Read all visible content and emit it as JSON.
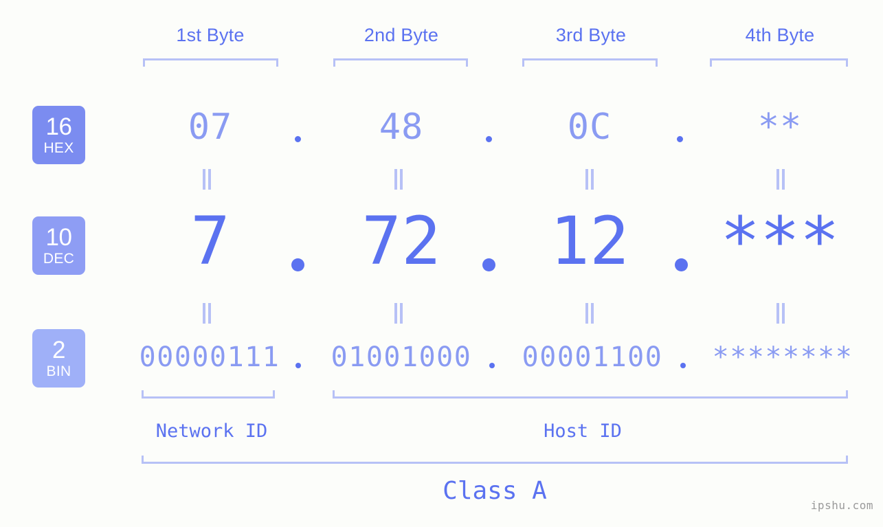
{
  "background_color": "#fcfdfa",
  "accent_color": "#5b72f0",
  "accent_light_color": "#8a9bf2",
  "bracket_color": "#b7c1f6",
  "columns": [
    {
      "header": "1st Byte"
    },
    {
      "header": "2nd Byte"
    },
    {
      "header": "3rd Byte"
    },
    {
      "header": "4th Byte"
    }
  ],
  "rows": [
    {
      "base_number": "16",
      "base_label": "HEX",
      "badge_color": "#7b8cf0",
      "values": [
        "07",
        "48",
        "0C",
        "**"
      ]
    },
    {
      "base_number": "10",
      "base_label": "DEC",
      "badge_color": "#8e9df4",
      "values": [
        "7",
        "72",
        "12",
        "***"
      ]
    },
    {
      "base_number": "2",
      "base_label": "BIN",
      "badge_color": "#9fb0f8",
      "values": [
        "00000111",
        "01001000",
        "00001100",
        "********"
      ]
    }
  ],
  "separator_glyph": "=",
  "dot_separator": ".",
  "network_id_label": "Network ID",
  "host_id_label": "Host ID",
  "class_label": "Class A",
  "watermark": "ipshu.com"
}
